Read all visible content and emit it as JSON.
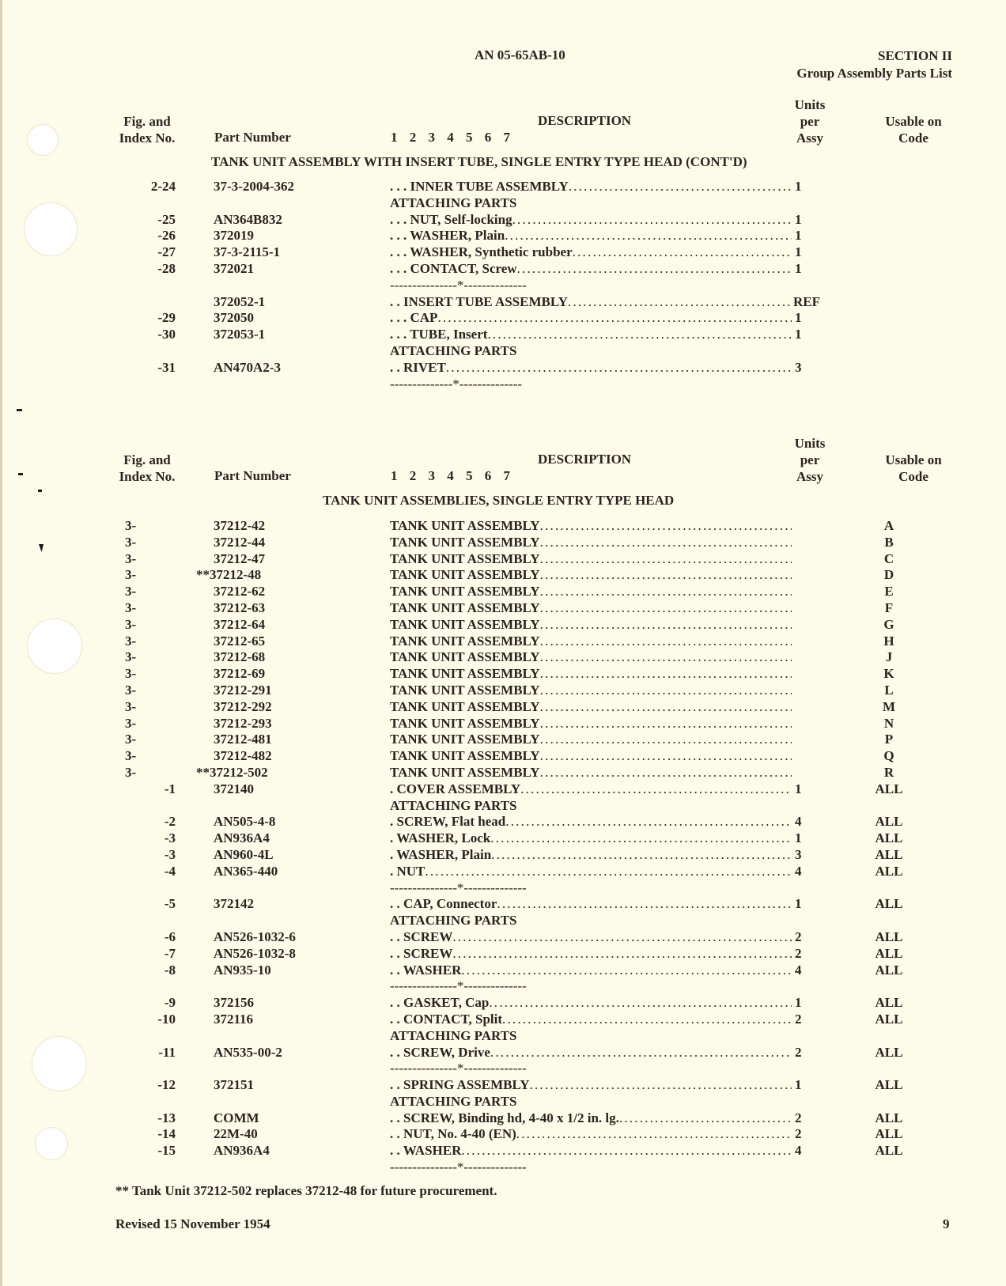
{
  "header": {
    "doc_number": "AN 05-65AB-10",
    "section": "SECTION II",
    "section_title": "Group Assembly Parts List"
  },
  "column_headers": {
    "fig_index": [
      "Fig. and",
      "Index No."
    ],
    "part_number": "Part Number",
    "indent_levels": "1 2 3 4 5 6 7",
    "description": "DESCRIPTION",
    "units_per_assy": [
      "Units",
      "per",
      "Assy"
    ],
    "usable_on_code": [
      "Usable on",
      "Code"
    ]
  },
  "table1": {
    "title": "TANK UNIT ASSEMBLY WITH INSERT TUBE, SINGLE ENTRY TYPE HEAD (CONT'D)",
    "rows": [
      {
        "index": "2-24",
        "part": "37-3-2004-362",
        "desc": ". . . INNER TUBE ASSEMBLY",
        "units": "1",
        "code": ""
      },
      {
        "index": "",
        "part": "",
        "desc": "ATTACHING PARTS",
        "units": "",
        "code": "",
        "type": "heading"
      },
      {
        "index": "-25",
        "part": "AN364B832",
        "desc": ". . . NUT, Self-locking",
        "units": "1",
        "code": ""
      },
      {
        "index": "-26",
        "part": "372019",
        "desc": ". . . WASHER, Plain",
        "units": "1",
        "code": ""
      },
      {
        "index": "-27",
        "part": "37-3-2115-1",
        "desc": ". . . WASHER, Synthetic rubber",
        "units": "1",
        "code": ""
      },
      {
        "index": "-28",
        "part": "372021",
        "desc": ". . . CONTACT, Screw",
        "units": "1",
        "code": ""
      },
      {
        "index": "",
        "part": "",
        "desc": "---------------*--------------",
        "units": "",
        "code": "",
        "type": "separator"
      },
      {
        "index": "",
        "part": "372052-1",
        "desc": ". . INSERT TUBE ASSEMBLY",
        "units": "REF",
        "code": ""
      },
      {
        "index": "-29",
        "part": "372050",
        "desc": ". . . CAP",
        "units": "1",
        "code": ""
      },
      {
        "index": "-30",
        "part": "372053-1",
        "desc": ". . . TUBE, Insert",
        "units": "1",
        "code": ""
      },
      {
        "index": "",
        "part": "",
        "desc": "ATTACHING PARTS",
        "units": "",
        "code": "",
        "type": "heading"
      },
      {
        "index": "-31",
        "part": "AN470A2-3",
        "desc": ". . RIVET",
        "units": "3",
        "code": ""
      },
      {
        "index": "",
        "part": "",
        "desc": "--------------*--------------",
        "units": "",
        "code": "",
        "type": "separator"
      }
    ]
  },
  "table2": {
    "title": "TANK UNIT ASSEMBLIES, SINGLE ENTRY TYPE HEAD",
    "rows": [
      {
        "index": "3-",
        "part": "37212-42",
        "desc": "TANK UNIT ASSEMBLY",
        "units": "",
        "code": "A"
      },
      {
        "index": "3-",
        "part": "37212-44",
        "desc": "TANK UNIT ASSEMBLY",
        "units": "",
        "code": "B"
      },
      {
        "index": "3-",
        "part": "37212-47",
        "desc": "TANK UNIT ASSEMBLY",
        "units": "",
        "code": "C"
      },
      {
        "index": "3-",
        "part": "**37212-48",
        "desc": "TANK UNIT ASSEMBLY",
        "units": "",
        "code": "D"
      },
      {
        "index": "3-",
        "part": "37212-62",
        "desc": "TANK UNIT ASSEMBLY",
        "units": "",
        "code": "E"
      },
      {
        "index": "3-",
        "part": "37212-63",
        "desc": "TANK UNIT ASSEMBLY",
        "units": "",
        "code": "F"
      },
      {
        "index": "3-",
        "part": "37212-64",
        "desc": "TANK UNIT ASSEMBLY",
        "units": "",
        "code": "G"
      },
      {
        "index": "3-",
        "part": "37212-65",
        "desc": "TANK UNIT ASSEMBLY",
        "units": "",
        "code": "H"
      },
      {
        "index": "3-",
        "part": "37212-68",
        "desc": "TANK UNIT ASSEMBLY",
        "units": "",
        "code": "J"
      },
      {
        "index": "3-",
        "part": "37212-69",
        "desc": "TANK UNIT ASSEMBLY",
        "units": "",
        "code": "K"
      },
      {
        "index": "3-",
        "part": "37212-291",
        "desc": "TANK UNIT ASSEMBLY",
        "units": "",
        "code": "L"
      },
      {
        "index": "3-",
        "part": "37212-292",
        "desc": "TANK UNIT ASSEMBLY",
        "units": "",
        "code": "M"
      },
      {
        "index": "3-",
        "part": "37212-293",
        "desc": "TANK UNIT ASSEMBLY",
        "units": "",
        "code": "N"
      },
      {
        "index": "3-",
        "part": "37212-481",
        "desc": "TANK UNIT ASSEMBLY",
        "units": "",
        "code": "P"
      },
      {
        "index": "3-",
        "part": "37212-482",
        "desc": "TANK UNIT ASSEMBLY",
        "units": "",
        "code": "Q"
      },
      {
        "index": "3-",
        "part": "**37212-502",
        "desc": "TANK UNIT ASSEMBLY",
        "units": "",
        "code": "R"
      },
      {
        "index": "-1",
        "part": "372140",
        "desc": ". COVER ASSEMBLY",
        "units": "1",
        "code": "ALL"
      },
      {
        "index": "",
        "part": "",
        "desc": "ATTACHING PARTS",
        "units": "",
        "code": "",
        "type": "heading"
      },
      {
        "index": "-2",
        "part": "AN505-4-8",
        "desc": ". SCREW, Flat head",
        "units": "4",
        "code": "ALL"
      },
      {
        "index": "-3",
        "part": "AN936A4",
        "desc": ". WASHER, Lock",
        "units": "1",
        "code": "ALL"
      },
      {
        "index": "-3",
        "part": "AN960-4L",
        "desc": ". WASHER, Plain",
        "units": "3",
        "code": "ALL"
      },
      {
        "index": "-4",
        "part": "AN365-440",
        "desc": ". NUT",
        "units": "4",
        "code": "ALL"
      },
      {
        "index": "",
        "part": "",
        "desc": "---------------*--------------",
        "units": "",
        "code": "",
        "type": "separator"
      },
      {
        "index": "-5",
        "part": "372142",
        "desc": ". . CAP, Connector",
        "units": "1",
        "code": "ALL"
      },
      {
        "index": "",
        "part": "",
        "desc": "ATTACHING PARTS",
        "units": "",
        "code": "",
        "type": "heading"
      },
      {
        "index": "-6",
        "part": "AN526-1032-6",
        "desc": ". . SCREW",
        "units": "2",
        "code": "ALL"
      },
      {
        "index": "-7",
        "part": "AN526-1032-8",
        "desc": ". . SCREW",
        "units": "2",
        "code": "ALL"
      },
      {
        "index": "-8",
        "part": "AN935-10",
        "desc": ". . WASHER",
        "units": "4",
        "code": "ALL"
      },
      {
        "index": "",
        "part": "",
        "desc": "---------------*--------------",
        "units": "",
        "code": "",
        "type": "separator"
      },
      {
        "index": "-9",
        "part": "372156",
        "desc": ". . GASKET, Cap",
        "units": "1",
        "code": "ALL"
      },
      {
        "index": "-10",
        "part": "372116",
        "desc": ". . CONTACT, Split",
        "units": "2",
        "code": "ALL"
      },
      {
        "index": "",
        "part": "",
        "desc": "ATTACHING PARTS",
        "units": "",
        "code": "",
        "type": "heading"
      },
      {
        "index": "-11",
        "part": "AN535-00-2",
        "desc": ". . SCREW, Drive",
        "units": "2",
        "code": "ALL"
      },
      {
        "index": "",
        "part": "",
        "desc": "---------------*--------------",
        "units": "",
        "code": "",
        "type": "separator"
      },
      {
        "index": "-12",
        "part": "372151",
        "desc": ". . SPRING ASSEMBLY",
        "units": "1",
        "code": "ALL"
      },
      {
        "index": "",
        "part": "",
        "desc": "ATTACHING PARTS",
        "units": "",
        "code": "",
        "type": "heading"
      },
      {
        "index": "-13",
        "part": "COMM",
        "desc": ". . SCREW, Binding hd, 4-40 x 1/2 in. lg.",
        "units": "2",
        "code": "ALL"
      },
      {
        "index": "-14",
        "part": "22M-40",
        "desc": ". . NUT, No. 4-40 (EN)",
        "units": "2",
        "code": "ALL"
      },
      {
        "index": "-15",
        "part": "AN936A4",
        "desc": ". . WASHER",
        "units": "4",
        "code": "ALL"
      },
      {
        "index": "",
        "part": "",
        "desc": "---------------*--------------",
        "units": "",
        "code": "",
        "type": "separator"
      }
    ]
  },
  "footnote": "** Tank Unit 37212-502 replaces 37212-48 for future procurement.",
  "footer": {
    "revision": "Revised 15 November 1954",
    "page_number": "9"
  },
  "colors": {
    "paper": "#fdfbe9",
    "ink": "#2a2320"
  }
}
